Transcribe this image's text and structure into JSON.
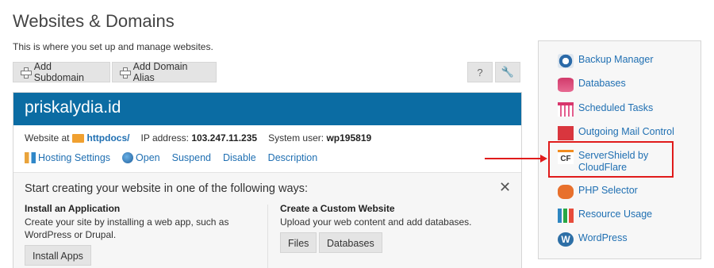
{
  "page": {
    "title": "Websites & Domains",
    "subtitle": "This is where you set up and manage websites."
  },
  "toolbar": {
    "add_subdomain_label": "Add Subdomain",
    "add_domain_alias_label": "Add Domain Alias",
    "help_icon": "?",
    "tools_icon": "🔧"
  },
  "domain": {
    "name": "priskalydia.id",
    "website_at_label": "Website at",
    "website_folder": "httpdocs/",
    "ip_label": "IP address:",
    "ip_value": "103.247.11.235",
    "user_label": "System user:",
    "user_value": "wp195819",
    "actions": [
      "Hosting Settings",
      "Open",
      "Suspend",
      "Disable",
      "Description"
    ]
  },
  "start": {
    "title": "Start creating your website in one of the following ways:",
    "close_icon": "✕",
    "app": {
      "heading": "Install an Application",
      "text": "Create your site by installing a web app, such as WordPress or Drupal.",
      "button": "Install Apps"
    },
    "custom": {
      "heading": "Create a Custom Website",
      "text": "Upload your web content and add databases.",
      "files_button": "Files",
      "databases_button": "Databases"
    }
  },
  "sidebar": {
    "items": [
      {
        "label": "Backup Manager",
        "icon": "backup-icon"
      },
      {
        "label": "Databases",
        "icon": "database-icon"
      },
      {
        "label": "Scheduled Tasks",
        "icon": "calendar-icon"
      },
      {
        "label": "Outgoing Mail Control",
        "icon": "mail-icon"
      },
      {
        "label": "ServerShield by CloudFlare",
        "icon": "cloudflare-icon",
        "icon_text": "CF"
      },
      {
        "label": "PHP Selector",
        "icon": "php-icon"
      },
      {
        "label": "Resource Usage",
        "icon": "resource-chart-icon"
      },
      {
        "label": "WordPress",
        "icon": "wordpress-icon",
        "icon_text": "W"
      }
    ]
  },
  "colors": {
    "header_blue": "#0b6ca3",
    "link_blue": "#1f6fb2",
    "annotation_red": "#e01b1b"
  }
}
